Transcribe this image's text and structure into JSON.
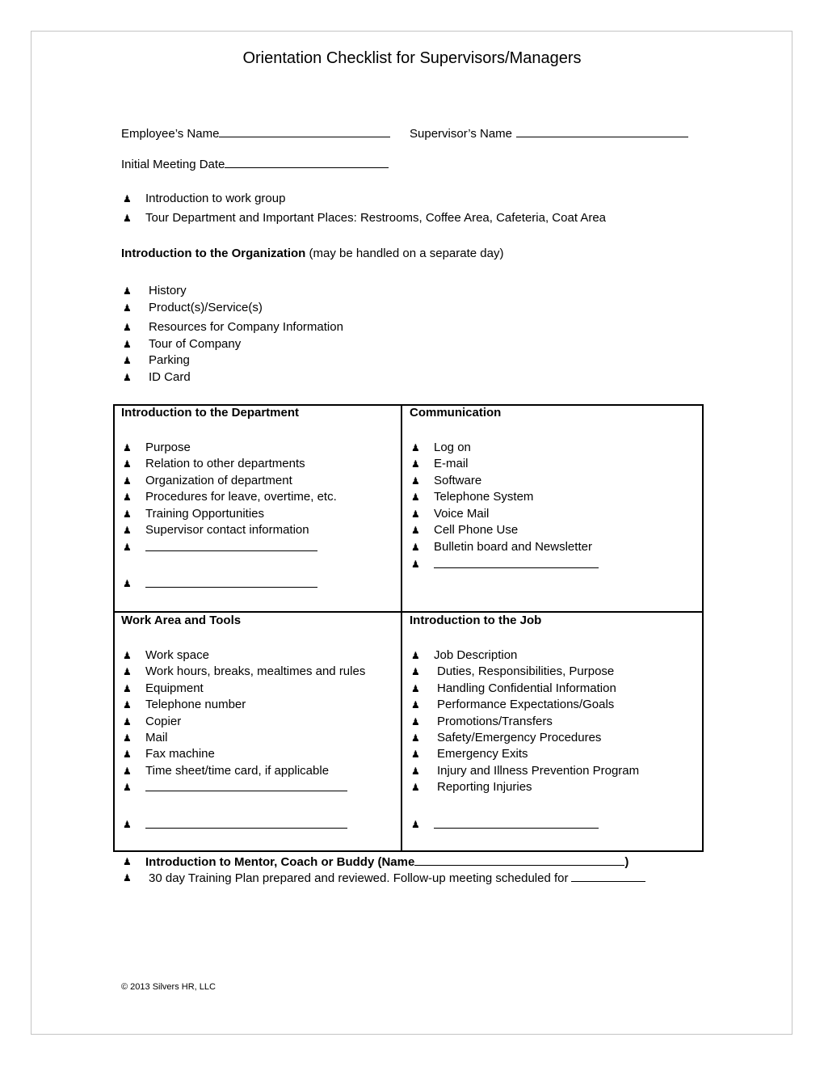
{
  "document": {
    "title": "Orientation Checklist for Supervisors/Managers",
    "bullet_glyph": "♟",
    "fields": {
      "employee_name_label": "Employee’s Name",
      "supervisor_name_label": "Supervisor’s Name",
      "initial_meeting_date_label": "Initial Meeting Date",
      "employee_name_value": "",
      "supervisor_name_value": "",
      "initial_meeting_date_value": ""
    },
    "intro_items": [
      "Introduction to work group",
      "Tour Department and Important Places: Restrooms, Coffee Area, Cafeteria, Coat Area"
    ],
    "organization": {
      "heading_bold": "Introduction to the Organization",
      "heading_note": " (may be handled on a separate day)",
      "items": [
        "History",
        "Product(s)/Service(s)",
        "Resources for Company Information",
        "Tour of Company",
        "Parking",
        "ID Card"
      ]
    },
    "sections": {
      "department": {
        "heading": "Introduction to the Department",
        "items": [
          "Purpose",
          "Relation to other departments",
          "Organization of department",
          "Procedures for leave, overtime, etc.",
          "Training Opportunities",
          "Supervisor contact information"
        ]
      },
      "communication": {
        "heading": "Communication",
        "items": [
          "Log on",
          "E-mail",
          "Software",
          "Telephone System",
          "Voice Mail",
          "Cell Phone Use",
          "Bulletin board and Newsletter"
        ]
      },
      "work_area": {
        "heading": "Work Area and Tools",
        "items": [
          "Work space",
          "Work hours, breaks, mealtimes and rules",
          "Equipment",
          "Telephone number",
          "Copier",
          "Mail",
          "Fax machine",
          "Time sheet/time card, if applicable"
        ]
      },
      "job": {
        "heading": "Introduction to the Job",
        "items": [
          "Job Description",
          "Duties, Responsibilities, Purpose",
          "Handling Confidential Information",
          "Performance Expectations/Goals",
          "Promotions/Transfers",
          "Safety/Emergency Procedures",
          "Emergency Exits",
          "Injury and Illness Prevention Program",
          "Reporting Injuries"
        ]
      }
    },
    "closing": {
      "mentor_label": "Introduction to Mentor, Coach or Buddy (Name",
      "mentor_close": ")",
      "training_plan_label": "30 day Training Plan prepared and reviewed.  Follow-up meeting scheduled for"
    },
    "footer": "© 2013 Silvers HR, LLC"
  }
}
